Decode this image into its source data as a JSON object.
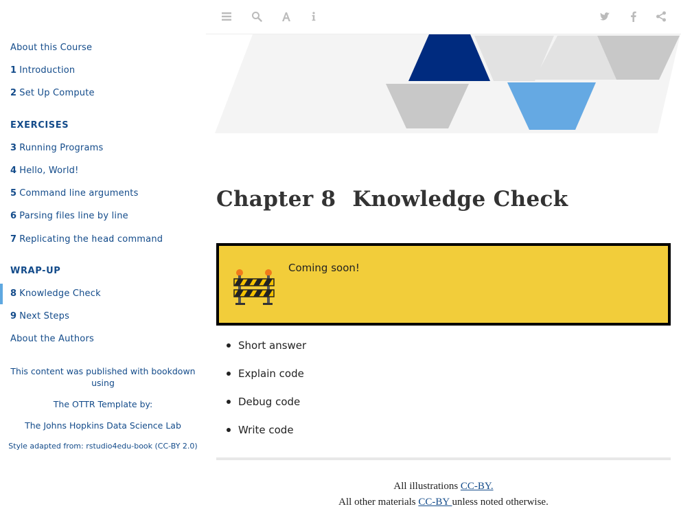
{
  "sidebar": {
    "items": [
      {
        "num": "",
        "label": "About this Course"
      },
      {
        "num": "1",
        "label": "Introduction"
      },
      {
        "num": "2",
        "label": "Set Up Compute"
      },
      {
        "num": "3",
        "label": "Running Programs"
      },
      {
        "num": "4",
        "label": "Hello, World!"
      },
      {
        "num": "5",
        "label": "Command line arguments"
      },
      {
        "num": "6",
        "label": "Parsing files line by line"
      },
      {
        "num": "7",
        "label_pre": "Replicating the ",
        "label_code": "head",
        "label_post": " command"
      },
      {
        "num": "8",
        "label": "Knowledge Check"
      },
      {
        "num": "9",
        "label": "Next Steps"
      },
      {
        "num": "",
        "label": "About the Authors"
      }
    ],
    "sections": {
      "exercises": "EXERCISES",
      "wrapup": "WRAP-UP"
    },
    "footer": {
      "published": "This content was published with bookdown using",
      "template": "The OTTR Template by:",
      "lab": "The Johns Hopkins Data Science Lab",
      "style": "Style adapted from: rstudio4edu-book (CC-BY 2.0)"
    }
  },
  "toolbar": {
    "icons": [
      "list-icon",
      "search-icon",
      "font-icon",
      "info-icon",
      "twitter-icon",
      "facebook-icon",
      "share-icon"
    ]
  },
  "main": {
    "chapter_label": "Chapter 8",
    "chapter_title": "Knowledge Check",
    "notice_text": "Coming soon!",
    "bullets": [
      "Short answer",
      "Explain code",
      "Debug code",
      "Write code"
    ],
    "footer": {
      "line1_pre": "All illustrations ",
      "line1_link": "CC-BY.",
      "line2_pre": "All other materials ",
      "line2_link": "CC-BY ",
      "line2_post": "unless noted otherwise."
    }
  },
  "colors": {
    "link": "#134b8a",
    "notice_bg": "#f2cd3a",
    "active_bar": "#5fa8e0",
    "banner_dark": "#002b7f",
    "banner_light": "#65a9e3"
  }
}
